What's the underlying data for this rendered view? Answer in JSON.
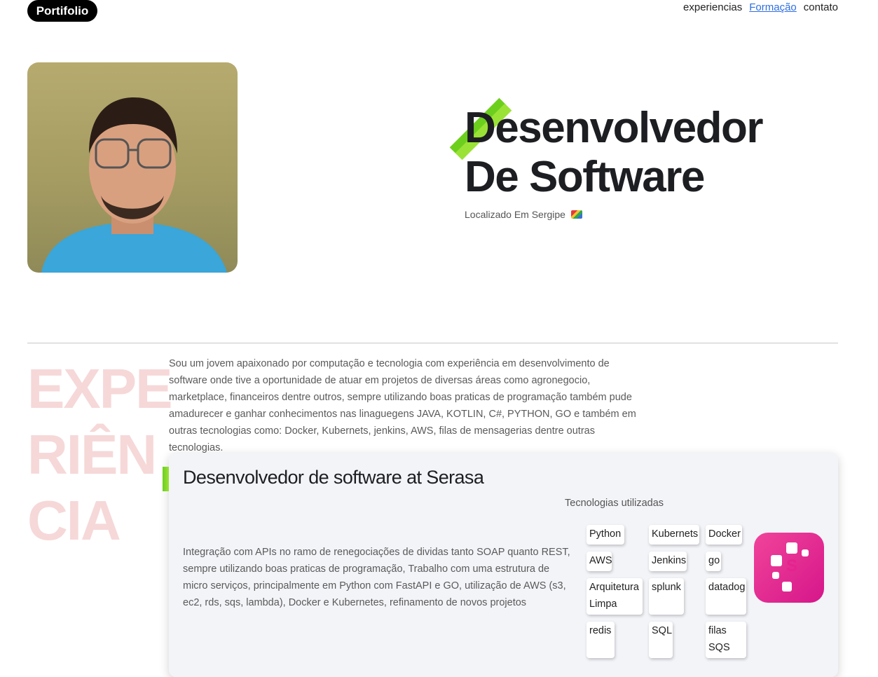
{
  "header": {
    "logo": "Portifolio",
    "nav": [
      "experiencias",
      "Formação",
      "contato"
    ],
    "active_nav": "Formação"
  },
  "hero": {
    "title_line1": "Desenvolvedor",
    "title_line2": "De Software",
    "location": "Localizado Em Sergipe"
  },
  "experience": {
    "side_word": [
      "EXPE",
      "RIÊN",
      "CIA"
    ],
    "about": "Sou um jovem apaixonado por computação e tecnologia com experiência em desenvolvimento de software onde tive a oportunidade de atuar em projetos de diversas áreas como agronegocio, marketplace, financeiros dentre outros, sempre utilizando boas praticas de programação também pude amadurecer e ganhar conhecimentos nas linaguegens JAVA, KOTLIN, C#, PYTHON, GO e também em outras tecnologias como: Docker, Kubernets, jenkins, AWS, filas de mensagerias dentre outras tecnologias.",
    "job": {
      "title": "Desenvolvedor de software at Serasa",
      "description": "Integração com APIs no ramo de renegociações de dividas tanto SOAP quanto REST, sempre utilizando boas praticas de programação, Trabalho com uma estrutura de micro serviços, principalmente em Python com FastAPI e GO, utilização de AWS (s3, ec2, rds, sqs, lambda), Docker e Kubernetes, refinamento de novos projetos",
      "tech_label": "Tecnologias utilizadas",
      "technologies": [
        "Python",
        "Kubernets",
        "Docker",
        "AWS",
        "Jenkins",
        "go",
        "Arquitetura Limpa",
        "splunk",
        "datadog",
        "redis",
        "SQL",
        "filas SQS"
      ]
    }
  },
  "colors": {
    "accent_green": "#6ccf1e",
    "serasa_pink": "#e5228f",
    "side_word": "#f6d8d8",
    "link_blue": "#2f6fe0"
  }
}
